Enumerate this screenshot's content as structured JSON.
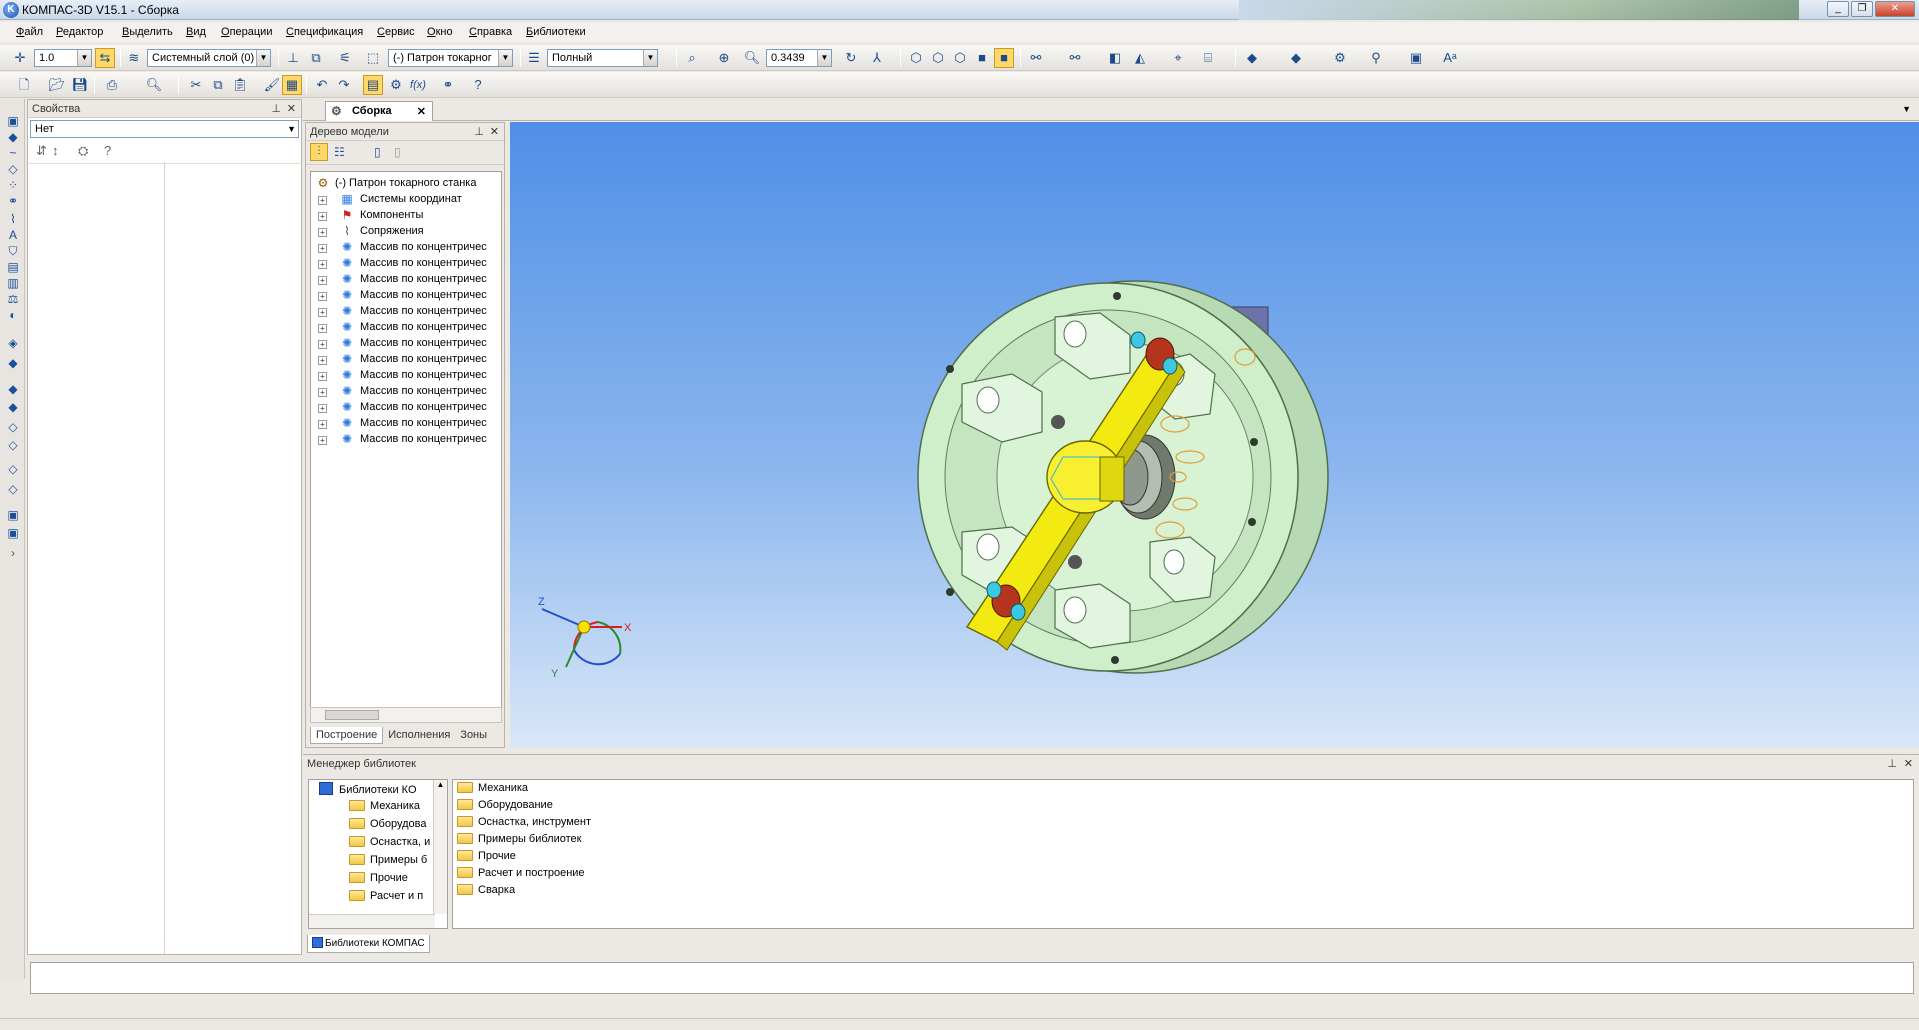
{
  "window": {
    "title": "КОМПАС-3D V15.1 - Сборка"
  },
  "menu": [
    "Файл",
    "Редактор",
    "Выделить",
    "Вид",
    "Операции",
    "Спецификация",
    "Сервис",
    "Окно",
    "Справка",
    "Библиотеки"
  ],
  "toolbar": {
    "step_value": "1.0",
    "layer": "Системный слой (0)",
    "assembly": "(-) Патрон токарног",
    "view_mode": "Полный",
    "zoom": "0.3439",
    "fx": "f(x)"
  },
  "properties": {
    "title": "Свойства",
    "selection": "Нет"
  },
  "doc_tab": {
    "label": "Сборка"
  },
  "model_tree": {
    "title": "Дерево модели",
    "root": "(-) Патрон токарного станка",
    "items": [
      {
        "label": "Системы координат",
        "icon": "coordinate-systems-icon"
      },
      {
        "label": "Компоненты",
        "icon": "components-icon"
      },
      {
        "label": "Сопряжения",
        "icon": "mates-icon"
      },
      {
        "label": "Массив по концентричес",
        "icon": "circular-array-icon"
      },
      {
        "label": "Массив по концентричес",
        "icon": "circular-array-icon"
      },
      {
        "label": "Массив по концентричес",
        "icon": "circular-array-icon"
      },
      {
        "label": "Массив по концентричес",
        "icon": "circular-array-icon"
      },
      {
        "label": "Массив по концентричес",
        "icon": "circular-array-icon"
      },
      {
        "label": "Массив по концентричес",
        "icon": "circular-array-icon"
      },
      {
        "label": "Массив по концентричес",
        "icon": "circular-array-icon"
      },
      {
        "label": "Массив по концентричес",
        "icon": "circular-array-icon"
      },
      {
        "label": "Массив по концентричес",
        "icon": "circular-array-icon"
      },
      {
        "label": "Массив по концентричес",
        "icon": "circular-array-icon"
      },
      {
        "label": "Массив по концентричес",
        "icon": "circular-array-icon"
      },
      {
        "label": "Массив по концентричес",
        "icon": "circular-array-icon"
      },
      {
        "label": "Массив по концентричес",
        "icon": "circular-array-icon"
      }
    ],
    "tabs": [
      "Построение",
      "Исполнения",
      "Зоны"
    ]
  },
  "viewport": {
    "axes": {
      "x": "X",
      "y": "Y",
      "z": "Z"
    }
  },
  "library_manager": {
    "title": "Менеджер библиотек",
    "tree_root": "Библиотеки КО",
    "tree_items": [
      "Механика",
      "Оборудова",
      "Оснастка, и",
      "Примеры б",
      "Прочие",
      "Расчет и п"
    ],
    "list_items": [
      "Механика",
      "Оборудование",
      "Оснастка, инструмент",
      "Примеры библиотек",
      "Прочие",
      "Расчет и построение",
      "Сварка"
    ],
    "tab": "Библиотеки КОМПАС"
  },
  "colors": {
    "viewport_top": "#4f8fe6",
    "viewport_bottom": "#d9e7f8",
    "chuck_body": "#c6e8c2",
    "jaw_arm": "#f2ea10",
    "active_button": "#ffd867"
  }
}
